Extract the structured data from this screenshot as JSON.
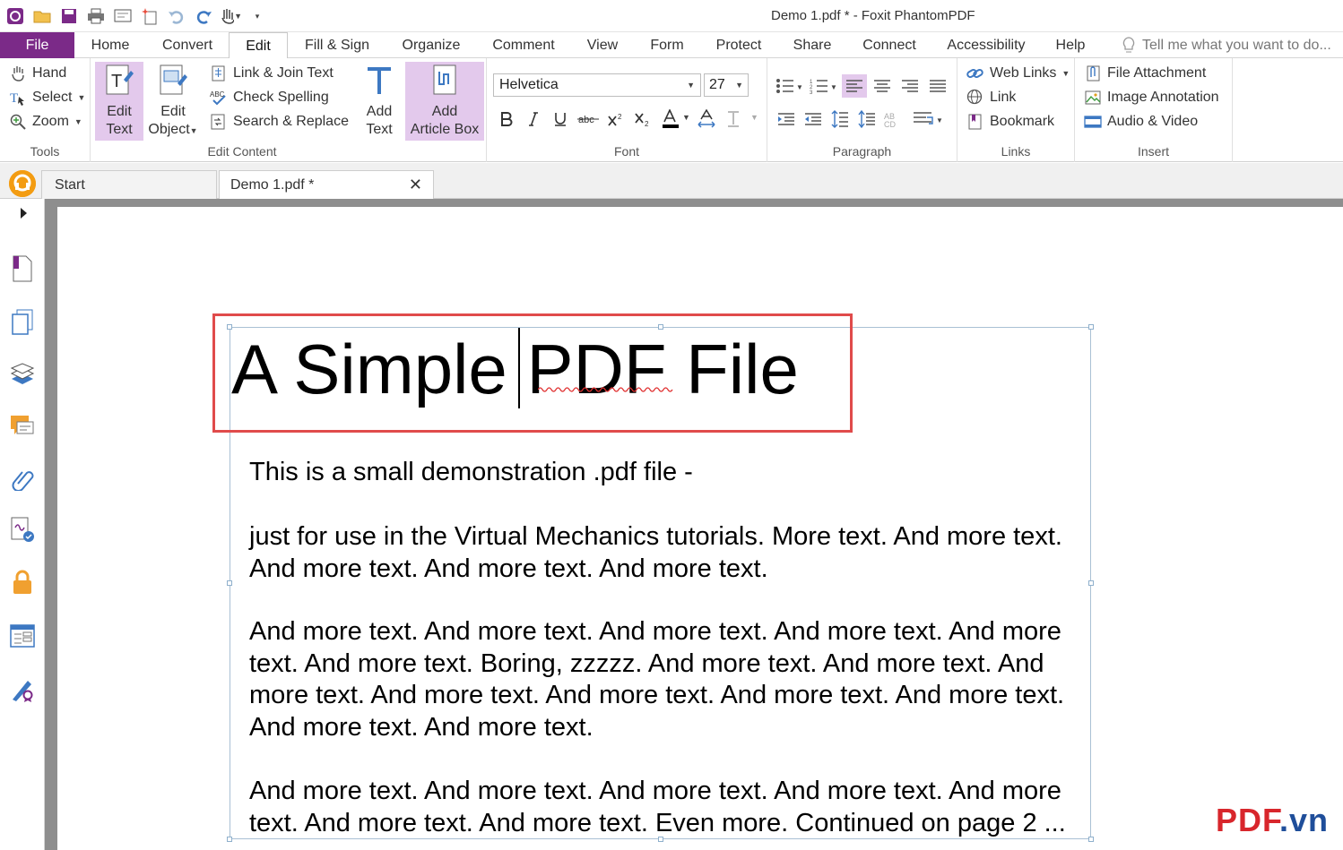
{
  "window": {
    "title": "Demo 1.pdf * - Foxit PhantomPDF"
  },
  "menu_tabs": [
    "File",
    "Home",
    "Convert",
    "Edit",
    "Fill & Sign",
    "Organize",
    "Comment",
    "View",
    "Form",
    "Protect",
    "Share",
    "Connect",
    "Accessibility",
    "Help"
  ],
  "tell_me": {
    "placeholder": "Tell me what you want to do..."
  },
  "ribbon": {
    "tools": {
      "hand": "Hand",
      "select": "Select",
      "zoom": "Zoom",
      "label": "Tools"
    },
    "edit_content": {
      "edit_text_l1": "Edit",
      "edit_text_l2": "Text",
      "edit_object_l1": "Edit",
      "edit_object_l2": "Object",
      "link_join": "Link & Join Text",
      "check_spelling": "Check Spelling",
      "search_replace": "Search & Replace",
      "label": "Edit Content"
    },
    "add_text_l1": "Add",
    "add_text_l2": "Text",
    "add_article_l1": "Add",
    "add_article_l2": "Article Box",
    "font": {
      "name": "Helvetica",
      "size": "27",
      "label": "Font"
    },
    "paragraph": {
      "label": "Paragraph"
    },
    "links": {
      "web_links": "Web Links",
      "link": "Link",
      "bookmark": "Bookmark",
      "label": "Links"
    },
    "insert": {
      "file_attachment": "File Attachment",
      "image_annotation": "Image Annotation",
      "audio_video": "Audio & Video",
      "label": "Insert"
    }
  },
  "doc_tabs": {
    "start": "Start",
    "demo": "Demo 1.pdf *"
  },
  "document": {
    "title": "A Simple PDF File",
    "paragraphs": [
      "This is a small demonstration .pdf file -",
      "just for use in the Virtual Mechanics tutorials. More text. And more text. And more text. And more text. And more text.",
      "And more text. And more text. And more text. And more text. And more text. And more text. Boring, zzzzz. And more text. And more text. And more text. And more text. And more text. And more text. And more text. And more text. And more text.",
      "And more text. And more text. And more text. And more text. And more text. And more text. And more text. Even more. Continued on page 2 ..."
    ]
  },
  "watermark": {
    "brand": "PDF",
    "tld": ".vn"
  },
  "colors": {
    "accent_purple": "#7b2a88",
    "highlight": "#e3c9ec",
    "selection_red": "#e04b4b",
    "watermark_red": "#d8262c",
    "watermark_blue": "#1f4e9a"
  }
}
